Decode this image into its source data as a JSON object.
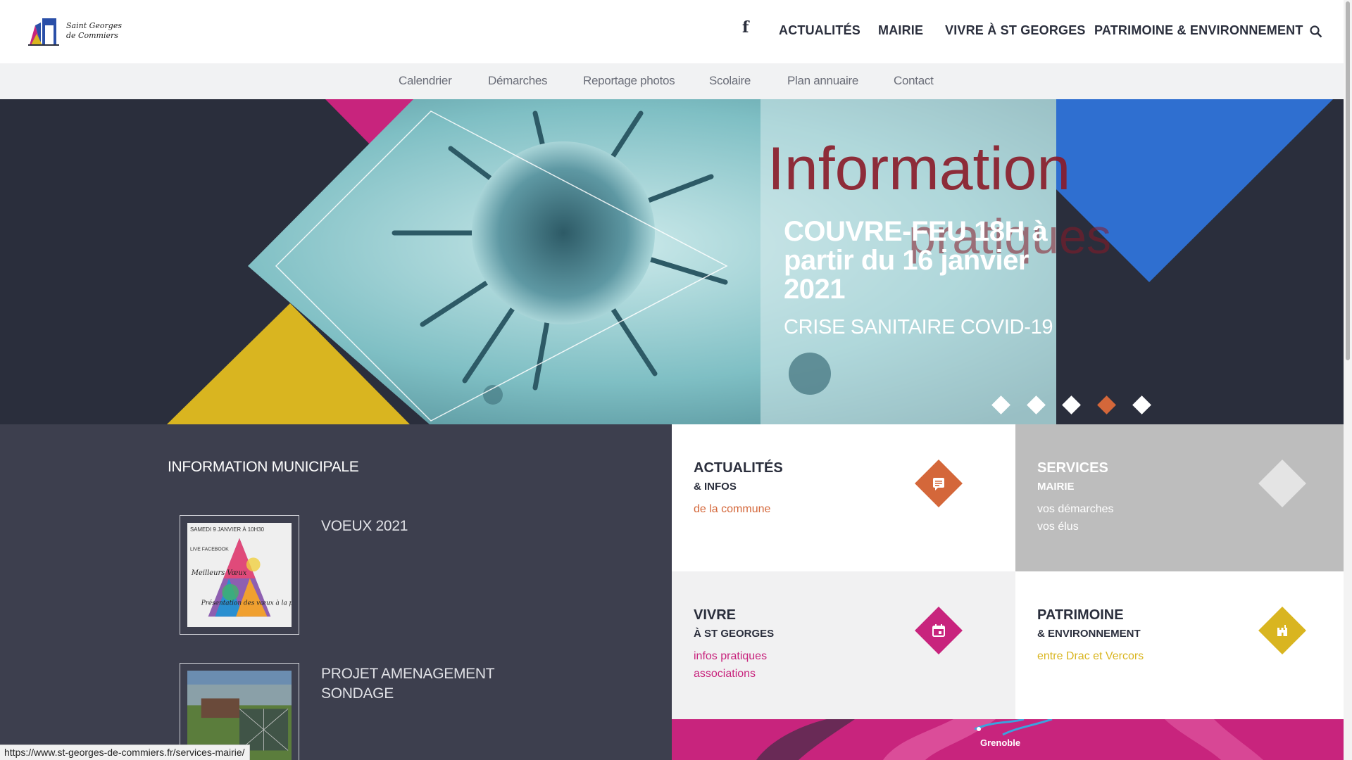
{
  "logo": {
    "line1": "Saint Georges",
    "line2": "de Commiers"
  },
  "header": {
    "facebook_icon": "facebook-icon",
    "nav": [
      "ACTUALITÉS",
      "MAIRIE",
      "VIVRE À ST GEORGES",
      "PATRIMOINE & ENVIRONNEMENT"
    ],
    "search_icon": "search-icon"
  },
  "subnav": [
    "Calendrier",
    "Démarches",
    "Reportage photos",
    "Scolaire",
    "Plan annuaire",
    "Contact"
  ],
  "hero": {
    "background_text_1": "Information",
    "background_text_2": "pratiques",
    "title": "COUVRE-FEU 18H à partir du 16 janvier 2021",
    "subtitle": "CRISE SANITAIRE COVID-19",
    "slides_count": 5,
    "active_slide": 4
  },
  "info": {
    "heading": "INFORMATION MUNICIPALE",
    "items": [
      {
        "title": "VOEUX 2021",
        "thumb_text": [
          "SAMEDI 9 JANVIER À 10H30",
          "LIVE FACEBOOK",
          "Meilleurs Vœux",
          "Présentation des vœux à la population"
        ]
      },
      {
        "title": "PROJET AMENAGEMENT SONDAGE"
      }
    ]
  },
  "tiles": [
    {
      "title": "ACTUALITÉS",
      "sub": "& INFOS",
      "links": [
        "de la commune"
      ],
      "icon": "news-icon",
      "accent": "#d4673a",
      "bg": "#ffffff"
    },
    {
      "title": "SERVICES",
      "sub": "MAIRIE",
      "links": [
        "vos démarches",
        "vos élus"
      ],
      "icon": "diamond-icon",
      "accent": "#e4e4e4",
      "bg": "#bdbdbd"
    },
    {
      "title": "VIVRE",
      "sub": "À ST GEORGES",
      "links": [
        "infos pratiques",
        "associations"
      ],
      "icon": "calendar-icon",
      "accent": "#c8247d",
      "bg": "#f1f1f2"
    },
    {
      "title": "PATRIMOINE",
      "sub": "& ENVIRONNEMENT",
      "links": [
        "entre Drac et Vercors"
      ],
      "icon": "castle-icon",
      "accent": "#d9b520",
      "bg": "#ffffff"
    }
  ],
  "map": {
    "label": "Grenoble"
  },
  "statusbar": {
    "url": "https://www.st-georges-de-commiers.fr/services-mairie/"
  }
}
